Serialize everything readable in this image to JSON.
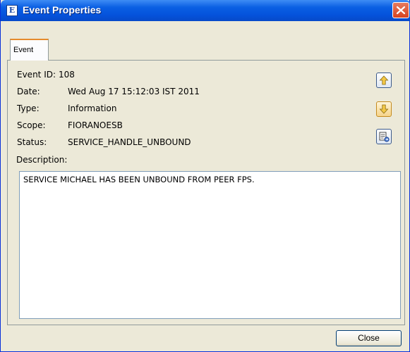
{
  "window": {
    "title": "Event Properties",
    "app_icon_letter": "E"
  },
  "tabs": [
    {
      "label": "Event"
    }
  ],
  "event": {
    "id_label": "Event ID:",
    "id_value": "108",
    "date_label": "Date:",
    "date_value": "Wed Aug 17 15:12:03 IST 2011",
    "type_label": "Type:",
    "type_value": "Information",
    "scope_label": "Scope:",
    "scope_value": "FIORANOESB",
    "status_label": "Status:",
    "status_value": "SERVICE_HANDLE_UNBOUND"
  },
  "description": {
    "label": "Description:",
    "text": "SERVICE MICHAEL HAS BEEN UNBOUND FROM PEER FPS."
  },
  "side_buttons": [
    {
      "icon": "arrow-up-icon"
    },
    {
      "icon": "arrow-down-icon"
    },
    {
      "icon": "copy-clipboard-icon"
    }
  ],
  "footer": {
    "close_label": "Close"
  },
  "colors": {
    "titlebar": "#0553dc",
    "close_button": "#d8431f",
    "window_bg": "#ece9d8",
    "tab_highlight": "#e68b2c"
  }
}
